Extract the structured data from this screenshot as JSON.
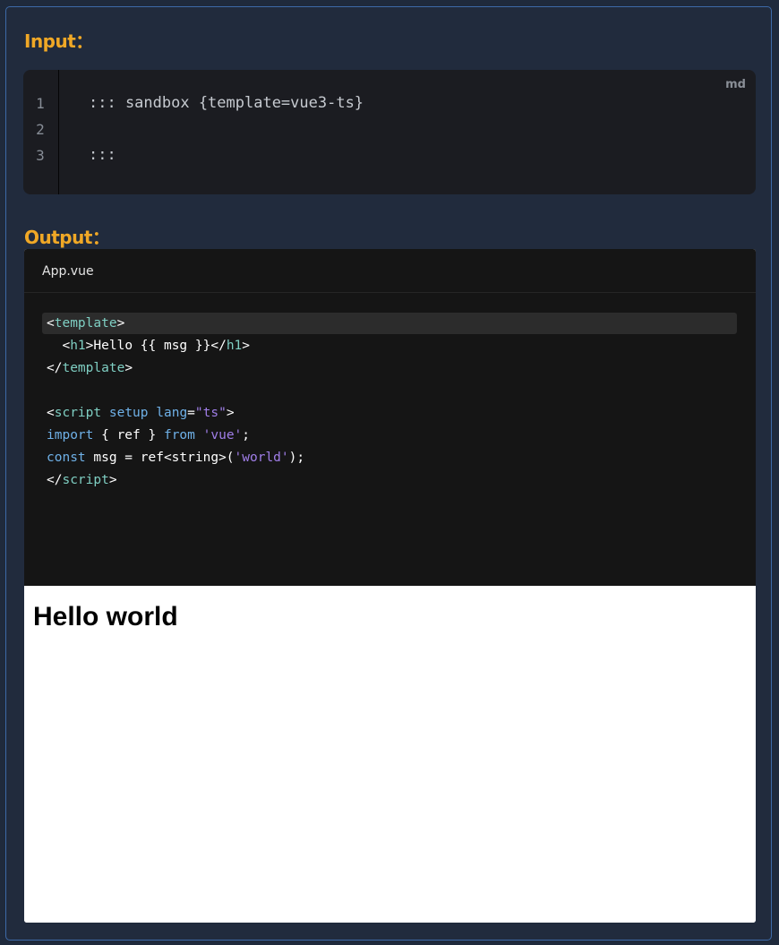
{
  "input": {
    "title": "Input：",
    "language_badge": "md",
    "lines": [
      {
        "number": "1",
        "text": "::: sandbox {template=vue3-ts}"
      },
      {
        "number": "2",
        "text": ""
      },
      {
        "number": "3",
        "text": ":::"
      }
    ]
  },
  "output": {
    "title": "Output：",
    "tab_label": "App.vue",
    "code": {
      "l1": {
        "open": "<",
        "tag": "template",
        "close": ">"
      },
      "l2": {
        "indent": "  ",
        "open": "<",
        "tag": "h1",
        "gt": ">",
        "text": "Hello {{ msg }}",
        "close_open": "</",
        "close_tag": "h1",
        "close_gt": ">"
      },
      "l3": {
        "open": "</",
        "tag": "template",
        "close": ">"
      },
      "l5": {
        "open": "<",
        "tag": "script",
        "sp1": " ",
        "attr1": "setup",
        "sp2": " ",
        "attr2": "lang",
        "eq": "=",
        "value": "\"ts\"",
        "close": ">"
      },
      "l6": {
        "kw1": "import",
        "mid": " { ref } ",
        "kw2": "from",
        "sp": " ",
        "str": "'vue'",
        "end": ";"
      },
      "l7": {
        "kw": "const",
        "mid": " msg = ref<string>(",
        "str": "'world'",
        "end": ");"
      },
      "l8": {
        "open": "</",
        "tag": "script",
        "close": ">"
      }
    },
    "preview_heading": "Hello world"
  },
  "colors": {
    "accent": "#f0a826",
    "frame_border": "#3d6aa8",
    "background": "#212b3d",
    "code_bg": "#151515",
    "tag": "#7fcfc3",
    "keyword": "#6fb1e8",
    "string": "#a07ee8"
  }
}
